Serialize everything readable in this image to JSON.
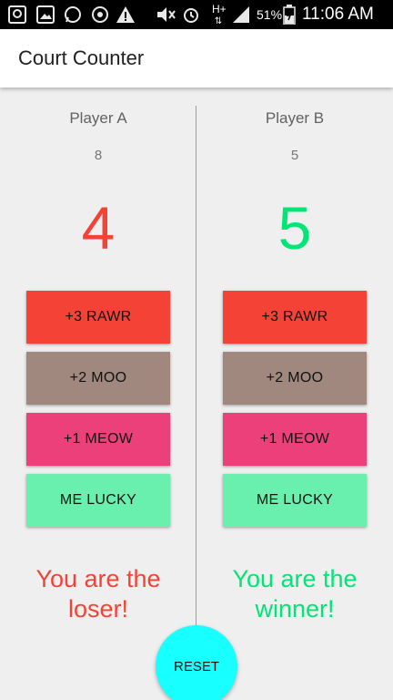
{
  "status_bar": {
    "signal_label": "H+",
    "battery_percent": "51%",
    "time": "11:06 AM",
    "icons": [
      "messaging-icon",
      "image-icon",
      "whatsapp-icon",
      "sync-icon",
      "alert-icon",
      "mute-icon",
      "alarm-icon",
      "network-type-icon",
      "signal-icon",
      "battery-icon"
    ]
  },
  "app_bar": {
    "title": "Court Counter"
  },
  "players": [
    {
      "name": "Player A",
      "aux_score": "8",
      "score": "4",
      "buttons": {
        "plus3": "+3 RAWR",
        "plus2": "+2 MOO",
        "plus1": "+1 MEOW",
        "lucky": "ME LUCKY"
      },
      "result": "You are the loser!",
      "score_color": "#f44336"
    },
    {
      "name": "Player B",
      "aux_score": "5",
      "score": "5",
      "buttons": {
        "plus3": "+3 RAWR",
        "plus2": "+2 MOO",
        "plus1": "+1 MEOW",
        "lucky": "ME LUCKY"
      },
      "result": "You are the winner!",
      "score_color": "#00e676"
    }
  ],
  "reset_label": "RESET",
  "colors": {
    "rawr": "#f44336",
    "moo": "#a1887f",
    "meow": "#ec407a",
    "lucky": "#69f0ae",
    "reset": "#18ffff",
    "loser": "#f44336",
    "winner": "#00e676",
    "background": "#efefef"
  }
}
